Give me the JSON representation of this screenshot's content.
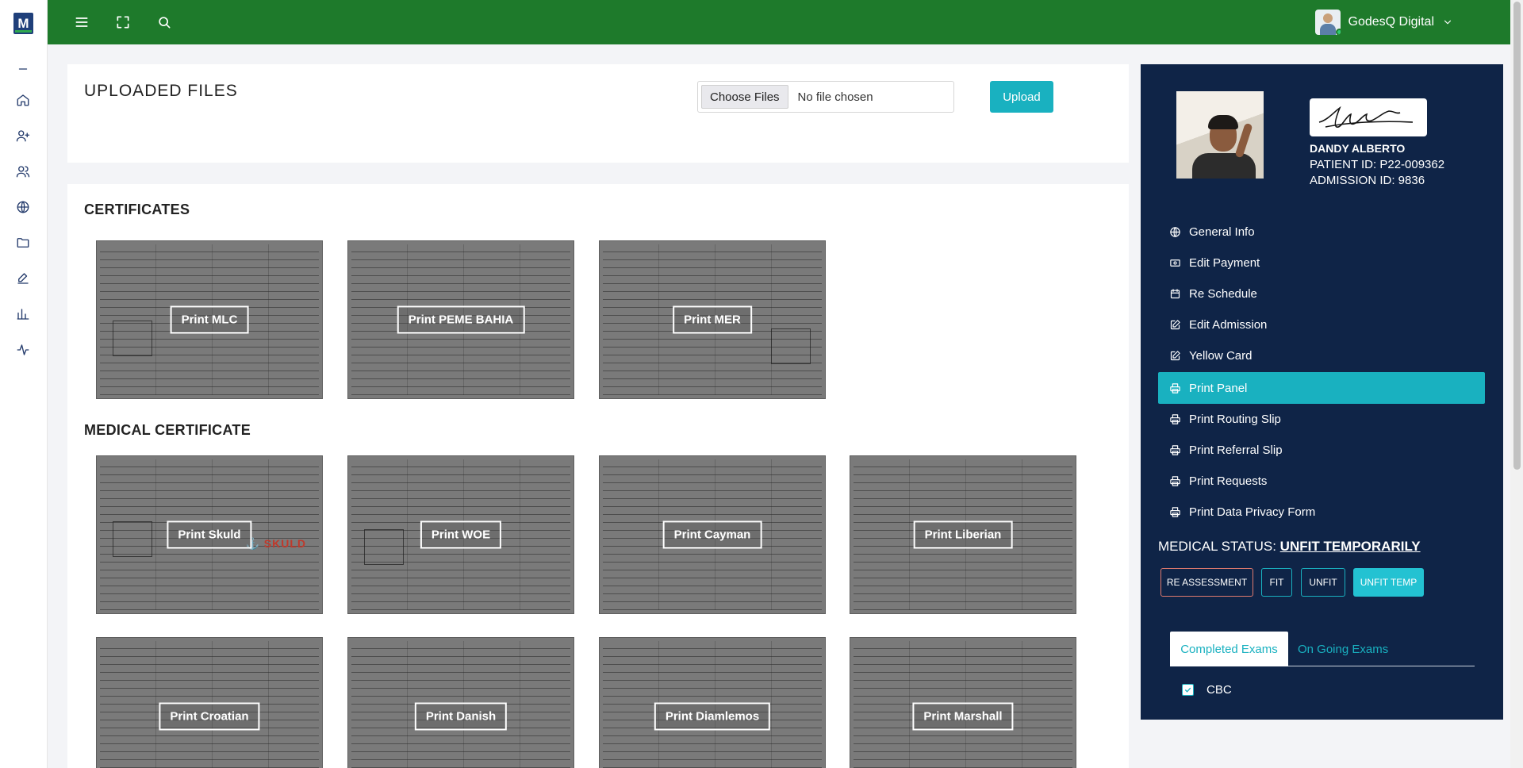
{
  "app": {
    "logo_text": "M"
  },
  "user": {
    "name": "GodesQ Digital"
  },
  "upload": {
    "title": "UPLOADED FILES",
    "choose_label": "Choose Files",
    "no_file_text": "No file chosen",
    "upload_label": "Upload"
  },
  "certificates": {
    "title": "CERTIFICATES",
    "items": [
      "Print MLC",
      "Print PEME BAHIA",
      "Print MER"
    ]
  },
  "medical_certificate": {
    "title": "MEDICAL CERTIFICATE",
    "items": [
      "Print Skuld",
      "Print WOE",
      "Print Cayman",
      "Print Liberian",
      "Print Croatian",
      "Print Danish",
      "Print Diamlemos",
      "Print Marshall"
    ],
    "skuld_mark": "⚓ SKULD"
  },
  "patient": {
    "name": "DANDY ALBERTO",
    "patient_id": "PATIENT ID: P22-009362",
    "admission_id": "ADMISSION ID: 9836"
  },
  "menu": [
    {
      "label": "General Info",
      "icon": "globe-icon"
    },
    {
      "label": "Edit Payment",
      "icon": "money-icon"
    },
    {
      "label": "Re Schedule",
      "icon": "calendar-icon"
    },
    {
      "label": "Edit Admission",
      "icon": "edit-icon"
    },
    {
      "label": "Yellow Card",
      "icon": "edit-icon"
    },
    {
      "label": "Print Panel",
      "icon": "printer-icon"
    },
    {
      "label": "Print Routing Slip",
      "icon": "printer-icon"
    },
    {
      "label": "Print Referral Slip",
      "icon": "printer-icon"
    },
    {
      "label": "Print Requests",
      "icon": "printer-icon"
    },
    {
      "label": "Print Data Privacy Form",
      "icon": "printer-icon"
    }
  ],
  "medical_status": {
    "label": "MEDICAL STATUS:",
    "value": "UNFIT TEMPORARILY",
    "buttons": [
      "RE ASSESSMENT",
      "FIT",
      "UNFIT",
      "UNFIT TEMP"
    ]
  },
  "exam_tabs": [
    "Completed Exams",
    "On Going Exams"
  ],
  "exams": [
    "CBC"
  ],
  "colors": {
    "topbar": "#1e7a2b",
    "accent": "#19b1c0",
    "panel": "#0f2447"
  }
}
